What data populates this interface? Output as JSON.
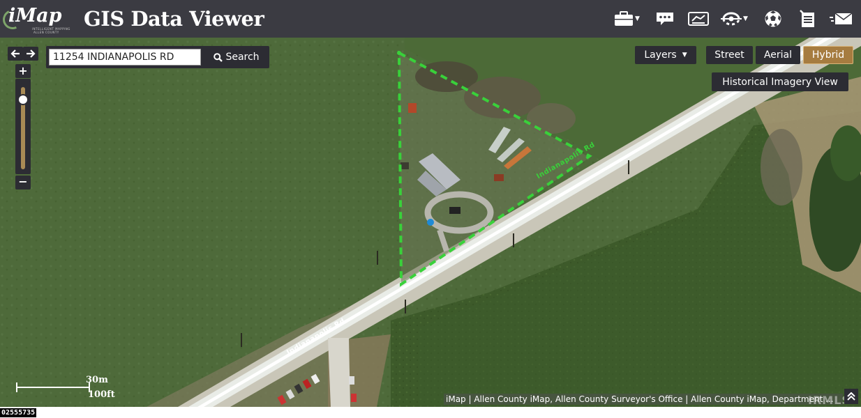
{
  "header": {
    "logo_text": "iMap",
    "logo_sub": "INTELLIGENT MAPPING",
    "logo_sub2": "ALLEN COUNTY",
    "title": "GIS Data Viewer",
    "tools": [
      {
        "name": "briefcase-icon",
        "has_dropdown": true
      },
      {
        "name": "comment-icon",
        "has_dropdown": false
      },
      {
        "name": "layers-card-icon",
        "has_dropdown": false
      },
      {
        "name": "measure-icon",
        "has_dropdown": true
      },
      {
        "name": "soccer-ball-icon",
        "has_dropdown": false
      },
      {
        "name": "notes-icon",
        "has_dropdown": false
      },
      {
        "name": "mail-icon",
        "has_dropdown": false
      }
    ]
  },
  "search": {
    "value": "11254 INDIANAPOLIS RD",
    "button_label": "Search"
  },
  "map_controls": {
    "zoom_in_label": "+",
    "zoom_out_label": "−",
    "zoom_level_fraction": 0.1
  },
  "basemap": {
    "layers_label": "Layers",
    "street_label": "Street",
    "aerial_label": "Aerial",
    "hybrid_label": "Hybrid",
    "active": "Hybrid",
    "historical_label": "Historical Imagery View"
  },
  "map": {
    "road_label": "Indianapolis Rd",
    "parcel_color": "#39d13a",
    "scale_metric": "30m",
    "scale_imperial": "100ft"
  },
  "attribution": "iMap | Allen County iMap, Allen County Surveyor's Office | Allen County iMap, Department ...",
  "watermark": "IRMLS",
  "listing_id": "02555735",
  "colors": {
    "header_bg": "#3b3b42",
    "control_bg": "#2c2c33",
    "accent": "#a67c40"
  }
}
